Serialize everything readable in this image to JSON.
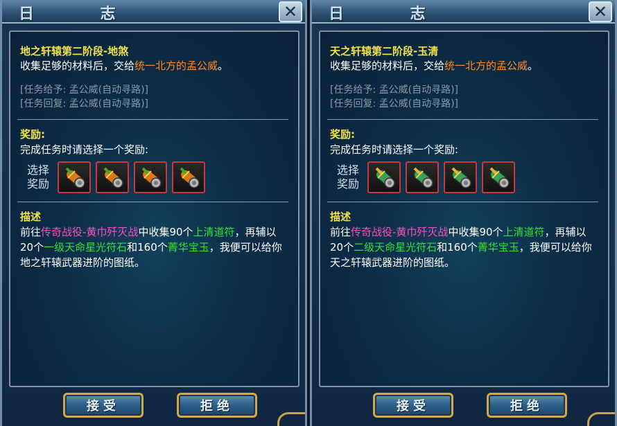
{
  "panels": [
    {
      "title": "日 志",
      "close_glyph": "✕",
      "quest_title": "地之轩辕第二阶段-地煞",
      "instruction_prefix": "收集足够的材料后，交给",
      "instruction_npc": "统一北方的孟公威",
      "instruction_suffix": "。",
      "giver": "[任务给予: 孟公威(自动寻路)]",
      "returner": "[任务回复: 孟公威(自动寻路)]",
      "reward_title": "奖励:",
      "reward_hint": "完成任务时请选择一个奖励:",
      "choose_label_1": "选择",
      "choose_label_2": "奖励",
      "desc_title": "描述",
      "desc": {
        "p1": "前往",
        "battle": "传奇战役-黄巾歼灭战",
        "p2": "中收集90个",
        "item1": "上清道符",
        "p3": "，再辅以20个",
        "item2": "一级天命星光符石",
        "p4": "和160个",
        "item3": "菁华宝玉",
        "p5": "，我便可以给你地之轩辕武器进阶的图纸。"
      },
      "accept_label": "接受",
      "reject_label": "拒绝"
    },
    {
      "title": "日 志",
      "close_glyph": "✕",
      "quest_title": "天之轩辕第二阶段-玉清",
      "instruction_prefix": "收集足够的材料后，交给",
      "instruction_npc": "统一北方的孟公威",
      "instruction_suffix": "。",
      "giver": "[任务给予: 孟公威(自动寻路)]",
      "returner": "[任务回复: 孟公威(自动寻路)]",
      "reward_title": "奖励:",
      "reward_hint": "完成任务时请选择一个奖励:",
      "choose_label_1": "选择",
      "choose_label_2": "奖励",
      "desc_title": "描述",
      "desc": {
        "p1": "前往",
        "battle": "传奇战役-黄巾歼灭战",
        "p2": "中收集90个",
        "item1": "上清道符",
        "p3": "，再辅以20个",
        "item2": "二级天命星光符石",
        "p4": "和160个",
        "item3": "菁华宝玉",
        "p5": "，我便可以给你天之轩辕武器进阶的图纸。"
      },
      "accept_label": "接受",
      "reject_label": "拒绝"
    }
  ],
  "icons": {
    "reward_item": "scroll-item-icon",
    "close": "close-icon"
  }
}
